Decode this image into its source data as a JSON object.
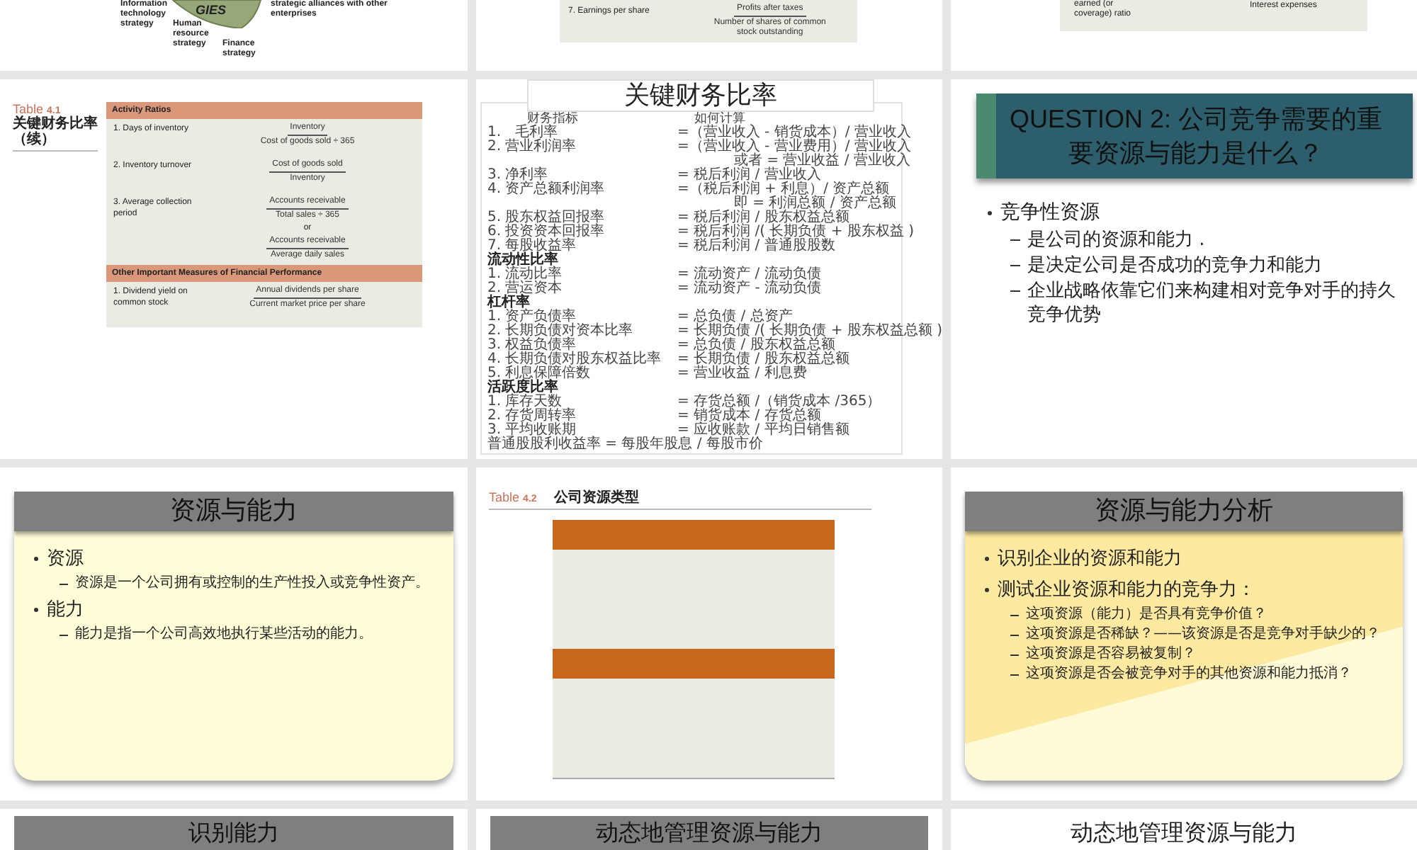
{
  "slides": [
    {
      "kind": "strategy_diagram",
      "wedge_text": "GIES",
      "labels": [
        "Information technology strategy",
        "Human resource strategy",
        "Finance strategy",
        "strategic alliances with other enterprises"
      ]
    },
    {
      "kind": "formula_strip",
      "label": "7.  Earnings per share",
      "numerator": "Profits after taxes",
      "denominator": "Number of shares of common stock outstanding"
    },
    {
      "kind": "formula_strip_end",
      "label": "earned (or coverage) ratio",
      "denominator": "Interest expenses"
    },
    {
      "kind": "ratio_table",
      "caption": "Table",
      "number": "4.1",
      "subtitle": "关键财务比率（续）",
      "sections": [
        {
          "header": "Activity Ratios",
          "rows": [
            {
              "label": "1.  Days of inventory",
              "formulas": [
                {
                  "num": "Inventory",
                  "den": "Cost of goods sold ÷ 365"
                }
              ]
            },
            {
              "label": "2.  Inventory turnover",
              "formulas": [
                {
                  "num": "Cost of goods sold",
                  "den": "Inventory"
                }
              ]
            },
            {
              "label": "3.  Average collection period",
              "joiner": "or",
              "formulas": [
                {
                  "num": "Accounts receivable",
                  "den": "Total sales ÷ 365"
                },
                {
                  "num": "Accounts receivable",
                  "den": "Average daily sales"
                }
              ]
            }
          ]
        },
        {
          "header": "Other Important Measures of Financial Performance",
          "rows": [
            {
              "label": "1.  Dividend yield on common stock",
              "formulas": [
                {
                  "num": "Annual dividends per share",
                  "den": "Current market price per share"
                }
              ]
            }
          ]
        }
      ]
    },
    {
      "kind": "cn_ratio_list",
      "title": "关键财务比率",
      "columns": [
        "财务指标",
        "如何计算"
      ],
      "lines": [
        {
          "kind": "item",
          "label": "1.　毛利率",
          "formula": "=（营业收入 - 销货成本）/ 营业收入"
        },
        {
          "kind": "item",
          "label": "2. 营业利润率",
          "formula": "=（营业收入 - 营业费用）/ 营业收入"
        },
        {
          "kind": "cont",
          "formula": "或者 = 营业收益 / 营业收入"
        },
        {
          "kind": "item",
          "label": "3. 净利率",
          "formula": "= 税后利润 / 营业收入"
        },
        {
          "kind": "item",
          "label": "4. 资产总额利润率",
          "formula": "=（税后利润 + 利息）/ 资产总额"
        },
        {
          "kind": "cont",
          "formula": "即 = 利润总额 / 资产总额"
        },
        {
          "kind": "item",
          "label": "5. 股东权益回报率",
          "formula": "= 税后利润 / 股东权益总额"
        },
        {
          "kind": "item",
          "label": "6. 投资资本回报率",
          "formula": "= 税后利润 /( 长期负债 + 股东权益 )"
        },
        {
          "kind": "item",
          "label": "7. 每股收益率",
          "formula": "= 税后利润 / 普通股股数"
        },
        {
          "kind": "heading",
          "label": "流动性比率"
        },
        {
          "kind": "item",
          "label": "1. 流动比率",
          "formula": "= 流动资产 / 流动负债"
        },
        {
          "kind": "item",
          "label": "2. 营运资本",
          "formula": "= 流动资产 - 流动负债"
        },
        {
          "kind": "heading",
          "label": "杠杆率"
        },
        {
          "kind": "item",
          "label": "1. 资产负债率",
          "formula": "= 总负债 / 总资产"
        },
        {
          "kind": "item",
          "label": "2. 长期负债对资本比率",
          "formula": "= 长期负债 /( 长期负债 + 股东权益总额 )"
        },
        {
          "kind": "item",
          "label": "3. 权益负债率",
          "formula": "= 总负债 / 股东权益总额"
        },
        {
          "kind": "item",
          "label": "4. 长期负债对股东权益比率",
          "formula": "= 长期负债 / 股东权益总额"
        },
        {
          "kind": "item",
          "label": "5. 利息保障倍数",
          "formula": "= 营业收益 / 利息费"
        },
        {
          "kind": "heading",
          "label": "活跃度比率"
        },
        {
          "kind": "item",
          "label": "1. 库存天数",
          "formula": "= 存货总额 /（销货成本 /365）"
        },
        {
          "kind": "item",
          "label": "2. 存货周转率",
          "formula": "= 销货成本 / 存货总额"
        },
        {
          "kind": "item",
          "label": "3. 平均收账期",
          "formula": "= 应收账款 / 平均日销售额"
        },
        {
          "kind": "full",
          "label": "普通股股利收益率 = 每股年股息 / 每股市价"
        }
      ]
    },
    {
      "kind": "question",
      "title": "QUESTION 2:  公司竞争需要的重要资源与能力是什么？",
      "bullets": [
        {
          "text": "竞争性资源",
          "children": [
            {
              "text": "是公司的资源和能力 ."
            },
            {
              "text": "是决定公司是否成功的竞争力和能力"
            },
            {
              "text": "企业战略依靠它们来构建相对竞争对手的持久竞争优势"
            }
          ]
        }
      ]
    },
    {
      "kind": "bullets",
      "title": "资源与能力",
      "bullets": [
        {
          "text": "资源",
          "children": [
            {
              "text": "资源是一个公司拥有或控制的生产性投入或竞争性资产。"
            }
          ]
        },
        {
          "text": "能力",
          "children": [
            {
              "text": "能力是指一个公司高效地执行某些活动的能力。"
            }
          ]
        }
      ]
    },
    {
      "kind": "table_image",
      "caption": "Table",
      "number": "4.2",
      "subtitle": "公司资源类型"
    },
    {
      "kind": "bullets_banded",
      "title": "资源与能力分析",
      "bullets": [
        {
          "text": "识别企业的资源和能力"
        },
        {
          "text": "测试企业资源和能力的竞争力：",
          "children": [
            {
              "text": "这项资源（能力）是否具有竞争价值？"
            },
            {
              "text": "这项资源是否稀缺？——该资源是否是竞争对手缺少的？"
            },
            {
              "text": "这项资源是否容易被复制？"
            },
            {
              "text": "这项资源是否会被竞争对手的其他资源和能力抵消？"
            }
          ]
        }
      ]
    },
    {
      "kind": "title_bar",
      "title": "识别能力"
    },
    {
      "kind": "title_bar",
      "title": "动态地管理资源与能力"
    },
    {
      "kind": "title_plain",
      "title": "动态地管理资源与能力"
    }
  ]
}
